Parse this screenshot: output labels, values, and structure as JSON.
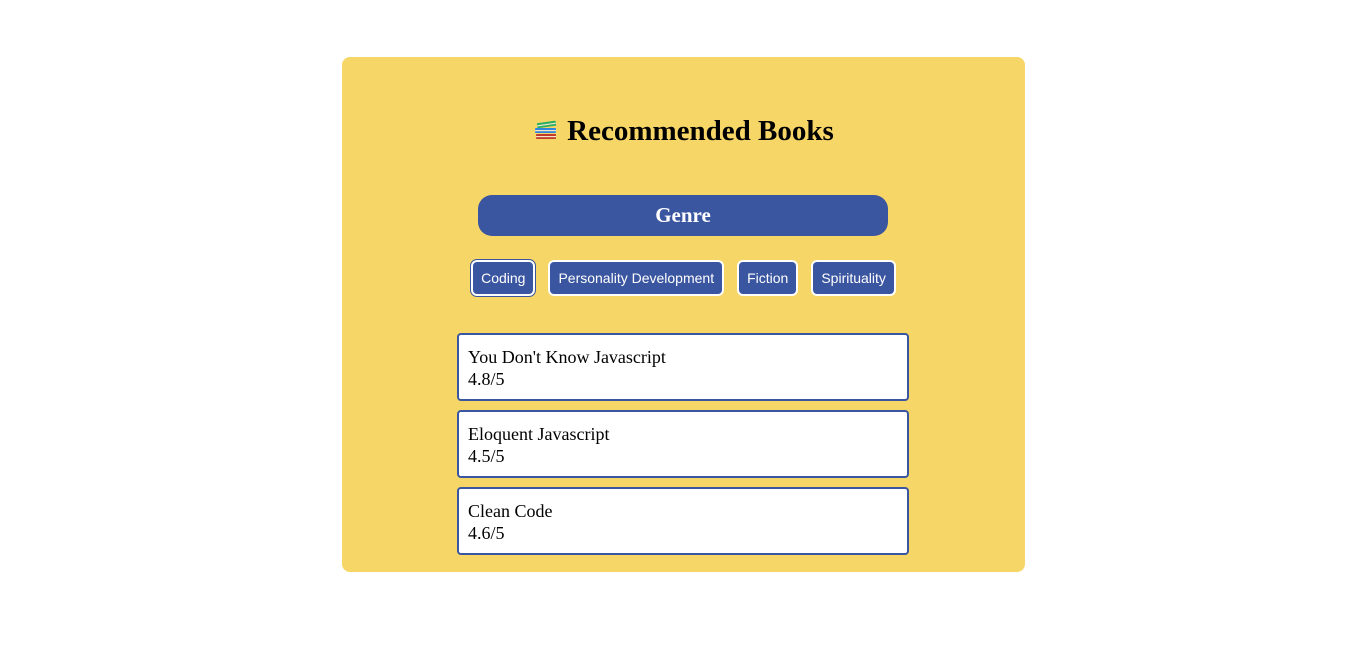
{
  "page": {
    "title_icon": "books-stack-icon",
    "title": "Recommended Books"
  },
  "genre": {
    "header": "Genre",
    "buttons": [
      {
        "label": "Coding",
        "active": true
      },
      {
        "label": "Personality Development",
        "active": false
      },
      {
        "label": "Fiction",
        "active": false
      },
      {
        "label": "Spirituality",
        "active": false
      }
    ]
  },
  "books": [
    {
      "name": "You Don't Know Javascript",
      "rating": "4.8/5"
    },
    {
      "name": "Eloquent Javascript",
      "rating": "4.5/5"
    },
    {
      "name": "Clean Code",
      "rating": "4.6/5"
    }
  ],
  "colors": {
    "card_background": "#f6d667",
    "accent": "#3b56a0",
    "item_background": "#ffffff"
  }
}
